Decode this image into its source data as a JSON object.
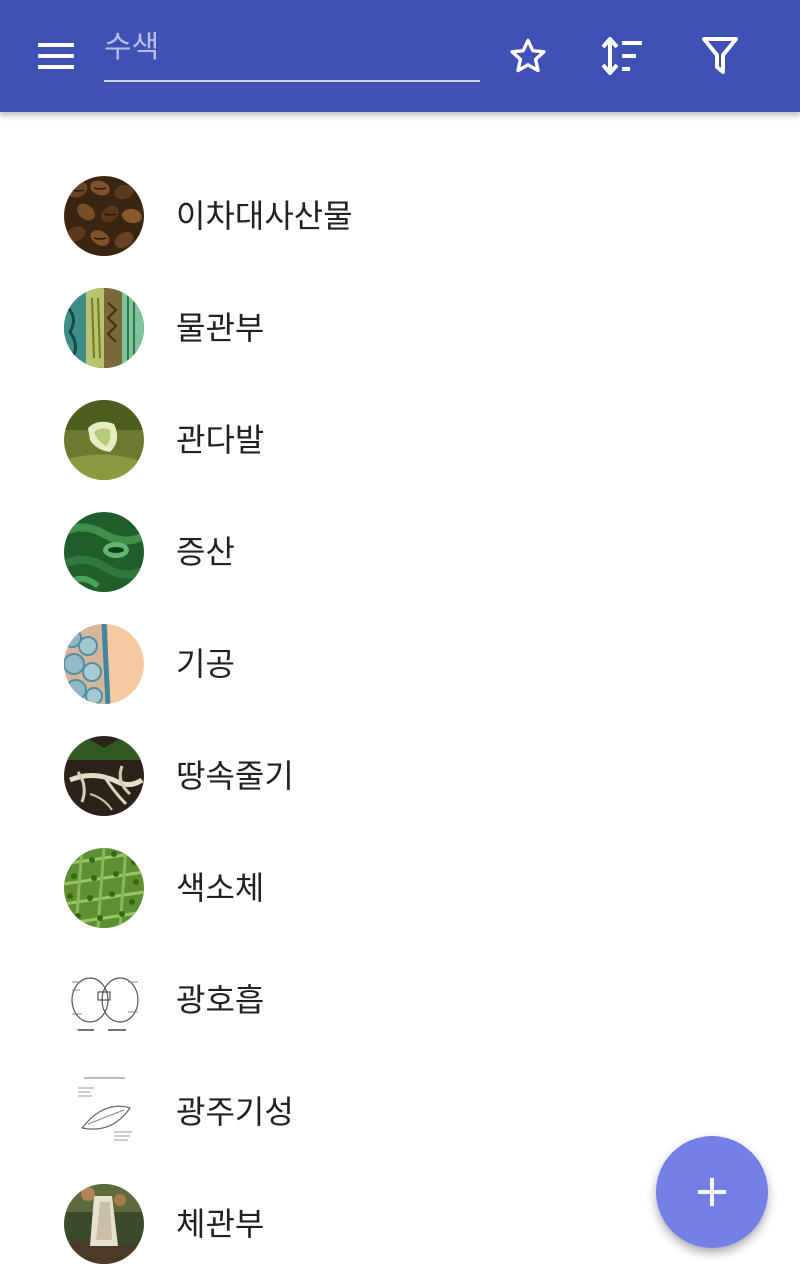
{
  "toolbar": {
    "menu_icon": "menu-icon",
    "search_placeholder": "수색",
    "search_value": "",
    "favorites_icon": "star-outline-icon",
    "sort_icon": "sort-icon",
    "filter_icon": "filter-icon",
    "background_color": "#3f51b5"
  },
  "list": {
    "items": [
      {
        "label": "이차대사산물"
      },
      {
        "label": "물관부"
      },
      {
        "label": "관다발"
      },
      {
        "label": "증산"
      },
      {
        "label": "기공"
      },
      {
        "label": "땅속줄기"
      },
      {
        "label": "색소체"
      },
      {
        "label": "광호흡"
      },
      {
        "label": "광주기성"
      },
      {
        "label": "체관부"
      }
    ]
  },
  "fab": {
    "icon": "plus-icon",
    "color": "#7580e6"
  }
}
